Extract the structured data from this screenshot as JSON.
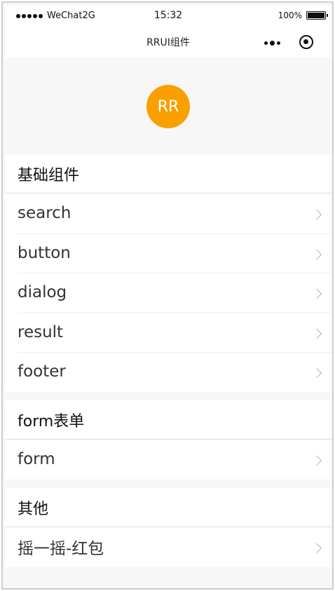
{
  "status_bar": {
    "carrier": "WeChat",
    "network": "2G",
    "time": "15:32",
    "battery": "100%",
    "battery_level": 1.0
  },
  "nav": {
    "title": "RRUI组件"
  },
  "avatar": {
    "initials": "RR",
    "color": "#f9a000"
  },
  "sections": [
    {
      "title": "基础组件",
      "items": [
        "search",
        "button",
        "dialog",
        "result",
        "footer"
      ]
    },
    {
      "title": "form表单",
      "items": [
        "form"
      ]
    },
    {
      "title": "其他",
      "items": [
        "摇一摇-红包"
      ]
    }
  ]
}
